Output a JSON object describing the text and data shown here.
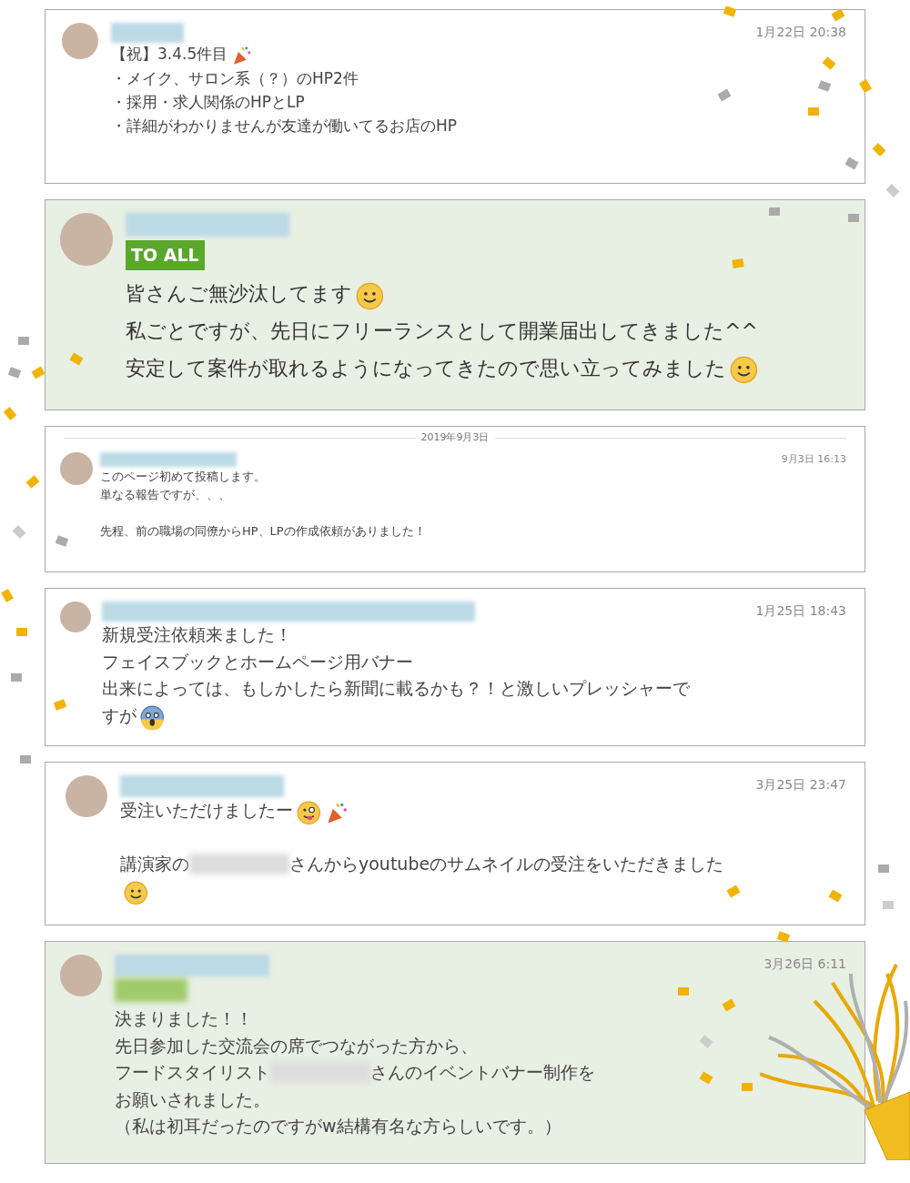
{
  "messages": [
    {
      "name_blurred": true,
      "timestamp": "1月22日 20:38",
      "highlighted": false,
      "lines": [
        [
          {
            "kind": "text",
            "text": "【祝】3.4.5件目"
          },
          {
            "kind": "popper"
          }
        ],
        [
          {
            "kind": "text",
            "text": "・メイク、サロン系（？）のHP2件"
          }
        ],
        [
          {
            "kind": "text",
            "text": "・採用・求人関係のHPとLP"
          }
        ],
        [
          {
            "kind": "text",
            "text": "・詳細がわかりませんが友達が働いてるお店のHP"
          }
        ]
      ]
    },
    {
      "name_blurred": true,
      "highlighted": true,
      "tag": {
        "text": "TO ALL"
      },
      "lines": [
        [
          {
            "kind": "text",
            "text": "皆さんご無沙汰してます"
          },
          {
            "kind": "smile"
          }
        ],
        [
          {
            "kind": "text",
            "text": "私ごとですが、先日にフリーランスとして開業届出してきました^^"
          }
        ],
        [
          {
            "kind": "text",
            "text": "安定して案件が取れるようになってきたので思い立ってみました"
          },
          {
            "kind": "smile"
          }
        ]
      ]
    },
    {
      "date_divider": "2019年9月3日",
      "name_blurred": true,
      "timestamp": "9月3日 16:13",
      "highlighted": false,
      "lines": [
        [
          {
            "kind": "text",
            "text": "このページ初めて投稿します。"
          }
        ],
        [
          {
            "kind": "text",
            "text": "単なる報告ですが、、、"
          }
        ],
        [
          {
            "kind": "gap"
          }
        ],
        [
          {
            "kind": "text",
            "text": "先程、前の職場の同僚からHP、LPの作成依頼がありました！"
          }
        ]
      ]
    },
    {
      "name_blurred": true,
      "timestamp": "1月25日 18:43",
      "highlighted": false,
      "lines": [
        [
          {
            "kind": "text",
            "text": "新規受注依頼来ました！"
          }
        ],
        [
          {
            "kind": "text",
            "text": "フェイスブックとホームページ用バナー"
          }
        ],
        [
          {
            "kind": "text",
            "text": "出来によっては、もしかしたら新聞に載るかも？！と激しいプレッシャーで"
          }
        ],
        [
          {
            "kind": "text",
            "text": "すが"
          },
          {
            "kind": "scream"
          }
        ]
      ]
    },
    {
      "name_blurred": true,
      "timestamp": "3月25日 23:47",
      "highlighted": false,
      "lines": [
        [
          {
            "kind": "text",
            "text": "受注いただけましたー"
          },
          {
            "kind": "tongue"
          },
          {
            "kind": "popper"
          }
        ],
        [
          {
            "kind": "gap"
          }
        ],
        [
          {
            "kind": "text",
            "text": "講演家の"
          },
          {
            "kind": "redacted"
          },
          {
            "kind": "text",
            "text": "さんからyoutubeのサムネイルの受注をいただきました"
          }
        ],
        [
          {
            "kind": "smile"
          }
        ]
      ]
    },
    {
      "name_blurred": true,
      "timestamp": "3月26日 6:11",
      "highlighted": true,
      "tag": {
        "blurred": true
      },
      "lines": [
        [
          {
            "kind": "text",
            "text": "決まりました！！"
          }
        ],
        [
          {
            "kind": "text",
            "text": "先日参加した交流会の席でつながった方から、"
          }
        ],
        [
          {
            "kind": "text",
            "text": "フードスタイリスト"
          },
          {
            "kind": "redacted"
          },
          {
            "kind": "text",
            "text": "さんのイベントバナー制作を"
          }
        ],
        [
          {
            "kind": "text",
            "text": "お願いされました。"
          }
        ],
        [
          {
            "kind": "text",
            "text": "（私は初耳だったのですがw結構有名な方らしいです。）"
          }
        ]
      ]
    }
  ]
}
